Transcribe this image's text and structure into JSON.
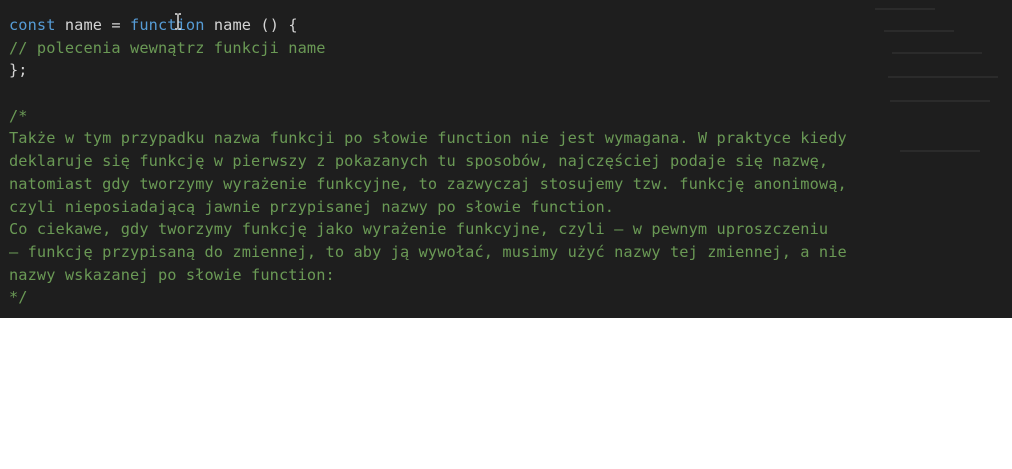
{
  "editor": {
    "lines": [
      {
        "tokens": [
          {
            "text": "const",
            "kind": "kw"
          },
          {
            "text": " name = ",
            "kind": "ident"
          },
          {
            "text": "function",
            "kind": "kw"
          },
          {
            "text": " name () {",
            "kind": "ident"
          }
        ]
      },
      {
        "tokens": [
          {
            "text": "// polecenia wewnątrz funkcji name",
            "kind": "comment"
          }
        ]
      },
      {
        "tokens": [
          {
            "text": "};",
            "kind": "ident"
          }
        ]
      },
      {
        "tokens": [
          {
            "text": "",
            "kind": "ident"
          }
        ]
      },
      {
        "tokens": [
          {
            "text": "/*",
            "kind": "comment"
          }
        ]
      },
      {
        "tokens": [
          {
            "text": "Także w tym przypadku nazwa funkcji po słowie function nie jest wymagana. W praktyce kiedy",
            "kind": "comment"
          }
        ]
      },
      {
        "tokens": [
          {
            "text": "deklaruje się funkcję w pierwszy z pokazanych tu sposobów, najczęściej podaje się nazwę,",
            "kind": "comment"
          }
        ]
      },
      {
        "tokens": [
          {
            "text": "natomiast gdy tworzymy wyrażenie funkcyjne, to zazwyczaj stosujemy tzw. funkcję anonimową,",
            "kind": "comment"
          }
        ]
      },
      {
        "tokens": [
          {
            "text": "czyli nieposiadającą jawnie przypisanej nazwy po słowie function.",
            "kind": "comment"
          }
        ]
      },
      {
        "tokens": [
          {
            "text": "Co ciekawe, gdy tworzymy funkcję jako wyrażenie funkcyjne, czyli — w pewnym uproszczeniu",
            "kind": "comment"
          }
        ]
      },
      {
        "tokens": [
          {
            "text": "— funkcję przypisaną do zmiennej, to aby ją wywołać, musimy użyć nazwy tej zmiennej, a nie",
            "kind": "comment"
          }
        ]
      },
      {
        "tokens": [
          {
            "text": "nazwy wskazanej po słowie function:",
            "kind": "comment"
          }
        ]
      },
      {
        "tokens": [
          {
            "text": "*/",
            "kind": "comment"
          }
        ]
      }
    ],
    "cursor_icon": "text-cursor-icon",
    "colors": {
      "background": "#1e1e1e",
      "keyword": "#569cd6",
      "identifier": "#d4d4d4",
      "comment": "#6a9955"
    }
  }
}
